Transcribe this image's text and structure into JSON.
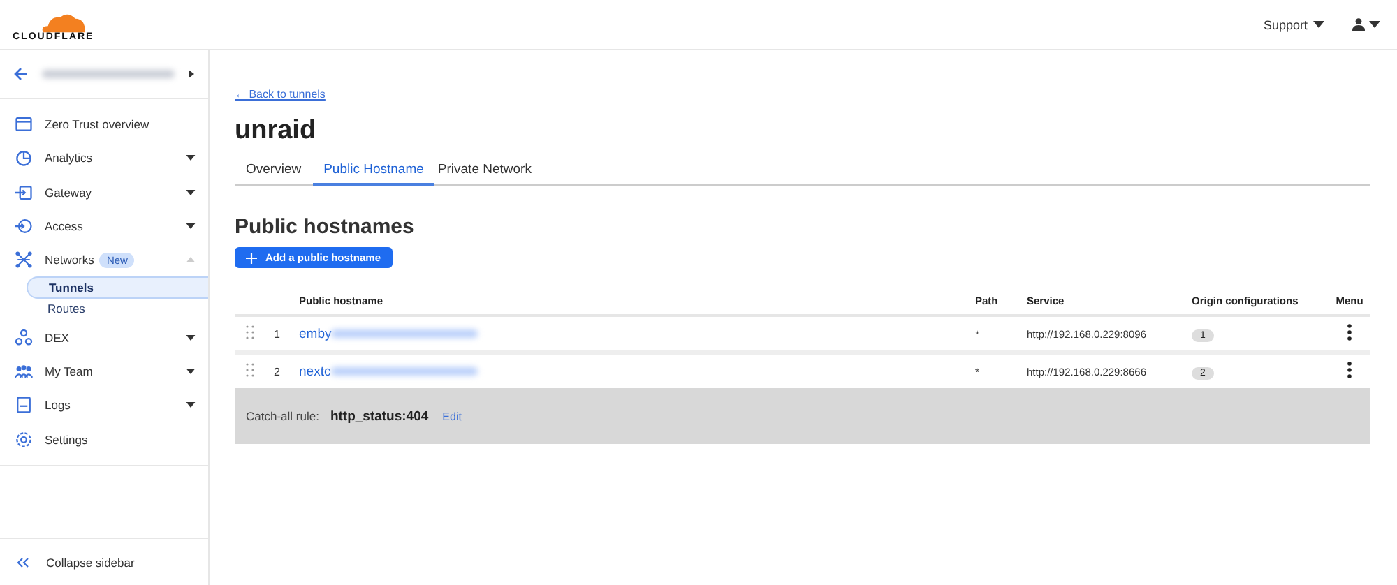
{
  "header": {
    "logo": "CLOUDFLARE",
    "support": "Support"
  },
  "sidebar": {
    "account": {
      "blurred": true
    },
    "items": [
      {
        "kind": "link",
        "label": "Zero Trust overview"
      },
      {
        "kind": "group",
        "label": "Analytics",
        "expanded": false
      },
      {
        "kind": "group",
        "label": "Gateway",
        "expanded": false
      },
      {
        "kind": "group",
        "label": "Access",
        "expanded": false
      },
      {
        "kind": "group",
        "label": "Networks",
        "badge": "New",
        "expanded": true,
        "children": [
          {
            "label": "Tunnels",
            "selected": true
          },
          {
            "label": "Routes",
            "selected": false
          }
        ]
      },
      {
        "kind": "group",
        "label": "DEX",
        "expanded": false
      },
      {
        "kind": "group",
        "label": "My Team",
        "expanded": false
      },
      {
        "kind": "group",
        "label": "Logs",
        "expanded": false
      },
      {
        "kind": "link",
        "label": "Settings"
      }
    ],
    "collapse": "Collapse sidebar"
  },
  "back_link": "← Back to tunnels",
  "title": "unraid",
  "tabs": [
    {
      "label": "Overview",
      "selected": false
    },
    {
      "label": "Public Hostname",
      "selected": true
    },
    {
      "label": "Private Network",
      "selected": false
    }
  ],
  "section_title": "Public hostnames",
  "add_button": "Add a public hostname",
  "table": {
    "columns": [
      "Public hostname",
      "Path",
      "Service",
      "Origin configurations",
      "Menu"
    ],
    "rows": [
      {
        "index": "1",
        "hostname": "emby",
        "hostname_blurred": true,
        "path": "*",
        "service": "http://192.168.0.229:8096",
        "origin_configurations": "1"
      },
      {
        "index": "2",
        "hostname": "nextc",
        "hostname_blurred": true,
        "path": "*",
        "service": "http://192.168.0.229:8666",
        "origin_configurations": "2"
      }
    ],
    "catch_all": {
      "label": "Catch-all rule:",
      "value": "http_status:404",
      "edit": "Edit"
    }
  }
}
